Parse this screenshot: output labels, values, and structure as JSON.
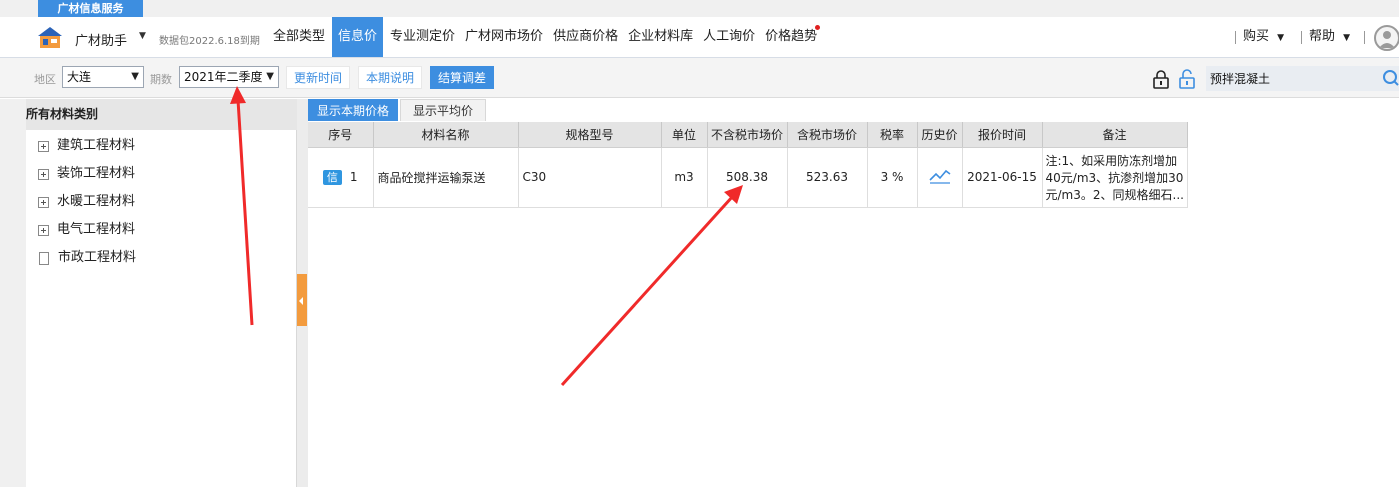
{
  "service_tab": "广材信息服务",
  "navbar": {
    "app_name": "广材助手",
    "package_note": "数据包2022.6.18到期",
    "items": [
      {
        "label": "全部类型"
      },
      {
        "label": "信息价",
        "active": true
      },
      {
        "label": "专业测定价"
      },
      {
        "label": "广材网市场价"
      },
      {
        "label": "供应商价格"
      },
      {
        "label": "企业材料库"
      },
      {
        "label": "人工询价"
      },
      {
        "label": "价格趋势",
        "has_dot": true
      }
    ],
    "buy_label": "购买",
    "help_label": "帮助"
  },
  "filter": {
    "region_label": "地区",
    "region_value": "大连",
    "period_label": "期数",
    "period_value": "2021年二季度",
    "buttons": {
      "update_time": "更新时间",
      "period_desc": "本期说明",
      "settle_adjust": "结算调差"
    },
    "search_value": "预拌混凝土"
  },
  "sidebar": {
    "title": "所有材料类别",
    "items": [
      {
        "label": "建筑工程材料",
        "icon": "plus-expander-icon"
      },
      {
        "label": "装饰工程材料",
        "icon": "plus-expander-icon"
      },
      {
        "label": "水暖工程材料",
        "icon": "plus-expander-icon"
      },
      {
        "label": "电气工程材料",
        "icon": "plus-expander-icon"
      },
      {
        "label": "市政工程材料",
        "icon": "document-icon"
      }
    ]
  },
  "subtabs": {
    "current": "显示本期价格",
    "average": "显示平均价"
  },
  "table": {
    "headers": [
      "序号",
      "材料名称",
      "规格型号",
      "单位",
      "不含税市场价",
      "含税市场价",
      "税率",
      "历史价",
      "报价时间",
      "备注"
    ],
    "rows": [
      {
        "tag": "信",
        "index": "1",
        "name": "商品砼搅拌运输泵送",
        "spec": "C30",
        "unit": "m3",
        "price_ex_tax": "508.38",
        "price_inc_tax": "523.63",
        "tax_rate": "3 %",
        "history_icon": "trend-chart-icon",
        "quote_date": "2021-06-15",
        "note": "注:1、如采用防冻剂增加40元/m3、抗渗剂增加30元/m3。2、同规格细石..."
      }
    ]
  },
  "colors": {
    "accent": "#3d8ee0",
    "annotation_arrow": "#f02a2a",
    "splitter_handle": "#f39b3e"
  }
}
